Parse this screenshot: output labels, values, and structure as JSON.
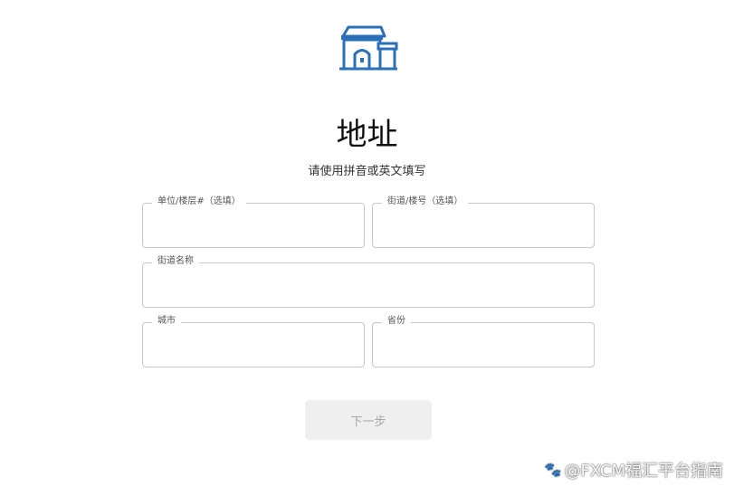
{
  "header": {
    "logo_icon": "storefront-icon",
    "title": "地址",
    "subtitle": "请使用拼音或英文填写"
  },
  "form": {
    "unit": {
      "label": "单位/楼层#（选填）",
      "value": ""
    },
    "street_number": {
      "label": "街道/楼号（选填）",
      "value": ""
    },
    "street_name": {
      "label": "街道名称",
      "value": ""
    },
    "city": {
      "label": "城市",
      "value": ""
    },
    "province": {
      "label": "省份",
      "value": ""
    }
  },
  "actions": {
    "next_label": "下一步"
  },
  "watermark": {
    "text": "@FXCM福汇平台指南",
    "icon": "paw-icon"
  },
  "colors": {
    "accent": "#2a6fb8",
    "button_bg": "#efefef",
    "button_text": "#a8a8a8",
    "border": "#c8c8c8"
  }
}
